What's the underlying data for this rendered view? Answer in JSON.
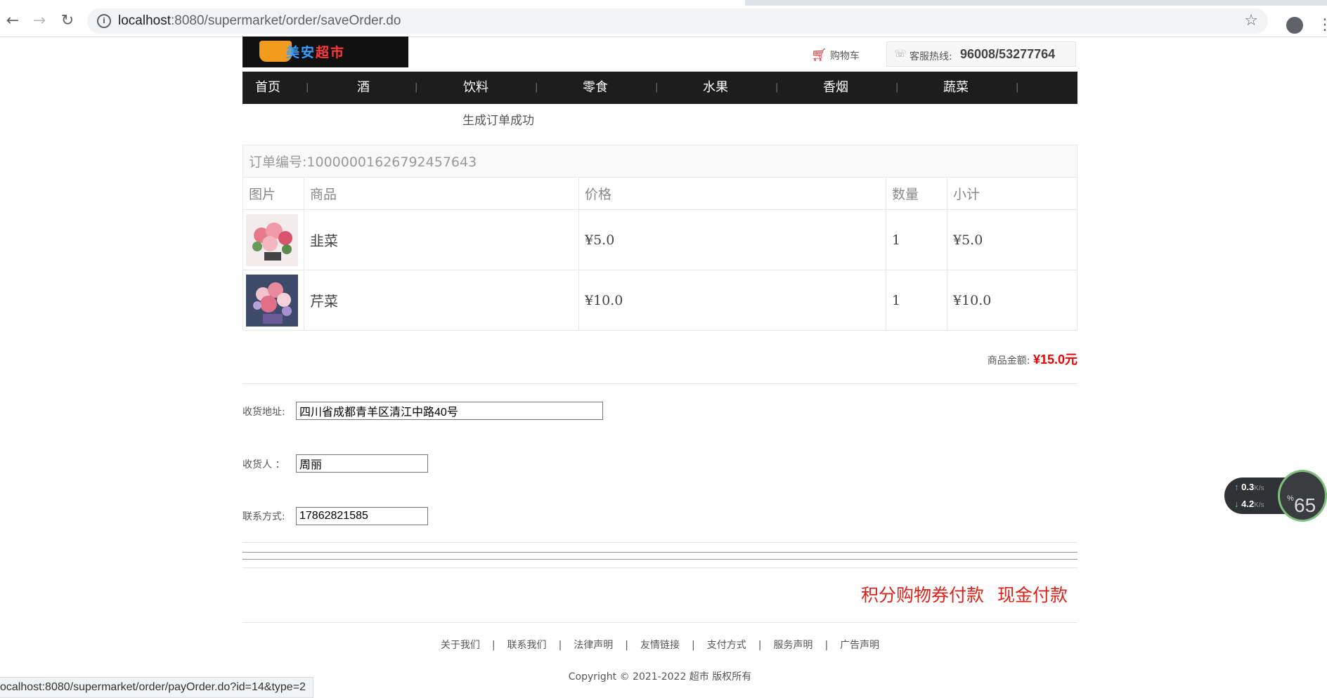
{
  "browser": {
    "url_host": "localhost",
    "url_path": ":8080/supermarket/order/saveOrder.do",
    "status_url": "ocalhost:8080/supermarket/order/payOrder.do?id=14&type=2"
  },
  "header": {
    "logo_text_a": "美安",
    "logo_text_b": "超市",
    "cart_label": "购物车",
    "hotline_label": "客服热线:",
    "hotline_number": "96008/53277764"
  },
  "nav": [
    "首页",
    "酒",
    "饮料",
    "零食",
    "水果",
    "香烟",
    "蔬菜"
  ],
  "nav_separator": "|",
  "order": {
    "success_message": "生成订单成功",
    "order_number": "订单编号:10000001626792457643",
    "columns": [
      "图片",
      "商品",
      "价格",
      "数量",
      "小计"
    ],
    "items": [
      {
        "name": "韭菜",
        "price": "¥5.0",
        "qty": "1",
        "subtotal": "¥5.0"
      },
      {
        "name": "芹菜",
        "price": "¥10.0",
        "qty": "1",
        "subtotal": "¥10.0"
      }
    ],
    "total_label": "商品金额:",
    "total_value": "¥15.0元"
  },
  "form": {
    "address_label": "收货地址:",
    "address_value": "四川省成都青羊区清江中路40号",
    "receiver_label": "收货人 ：",
    "receiver_value": "周丽",
    "phone_label": "联系方式:",
    "phone_value": "17862821585"
  },
  "payment": {
    "points_label": "积分购物券付款",
    "cash_label": "现金付款"
  },
  "footer": {
    "links": [
      "关于我们",
      "联系我们",
      "法律声明",
      "友情链接",
      "支付方式",
      "服务声明",
      "广告声明"
    ],
    "separator": "|",
    "copyright": "Copyright © 2021-2022 超市 版权所有"
  },
  "speed_widget": {
    "up": "0.3",
    "down": "4.2",
    "unit": "K/s",
    "percent": "65",
    "percent_sign": "%"
  },
  "colors": {
    "accent_red": "#d9241c",
    "nav_bg": "#1d1d1d"
  }
}
